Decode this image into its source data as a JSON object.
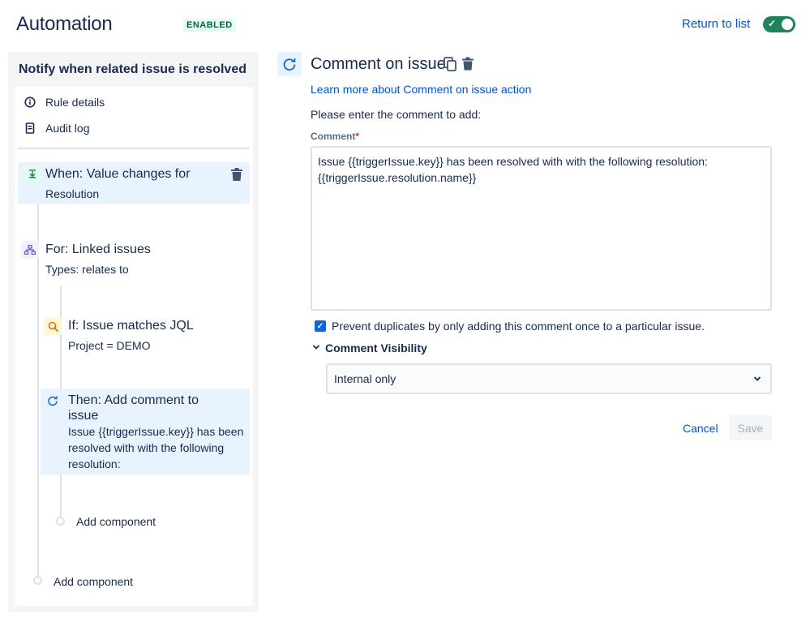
{
  "header": {
    "title": "Automation",
    "status_badge": "ENABLED",
    "return_link": "Return to list",
    "toggle_icon": "check-icon",
    "toggle_on": true
  },
  "rule": {
    "title": "Notify when related issue is resolved",
    "menu": [
      {
        "label": "Rule details",
        "icon": "info-icon"
      },
      {
        "label": "Audit log",
        "icon": "document-icon"
      }
    ],
    "components": {
      "trigger": {
        "title": "When: Value changes for",
        "subtitle": "Resolution",
        "icon": "trigger-icon"
      },
      "branch": {
        "title": "For: Linked issues",
        "subtitle": "Types: relates to",
        "icon": "branch-icon"
      },
      "condition": {
        "title": "If: Issue matches JQL",
        "subtitle": "Project = DEMO",
        "icon": "search-icon"
      },
      "action": {
        "title": "Then: Add comment to issue",
        "subtitle": "Issue {{triggerIssue.key}} has been resolved with with the following resolution:",
        "icon": "comment-action-icon"
      }
    },
    "add_component_inner": "Add component",
    "add_component_outer": "Add component"
  },
  "editor": {
    "title": "Comment on issue",
    "learn_more": "Learn more about Comment on issue action",
    "prompt": "Please enter the comment to add:",
    "comment_label": "Comment",
    "required_mark": "*",
    "comment_value": "Issue {{triggerIssue.key}} has been resolved with with the following resolution: {{triggerIssue.resolution.name}}",
    "prevent_duplicates_label": "Prevent duplicates by only adding this comment once to a particular issue.",
    "prevent_duplicates_checked": true,
    "visibility_label": "Comment Visibility",
    "visibility_value": "Internal only",
    "cancel_label": "Cancel",
    "save_label": "Save"
  },
  "colors": {
    "brand": "#0052cc",
    "toggle_on": "#1f845a",
    "selected_bg": "#e9f2ff",
    "badge_bg": "#e3fcef",
    "badge_text": "#006644"
  }
}
